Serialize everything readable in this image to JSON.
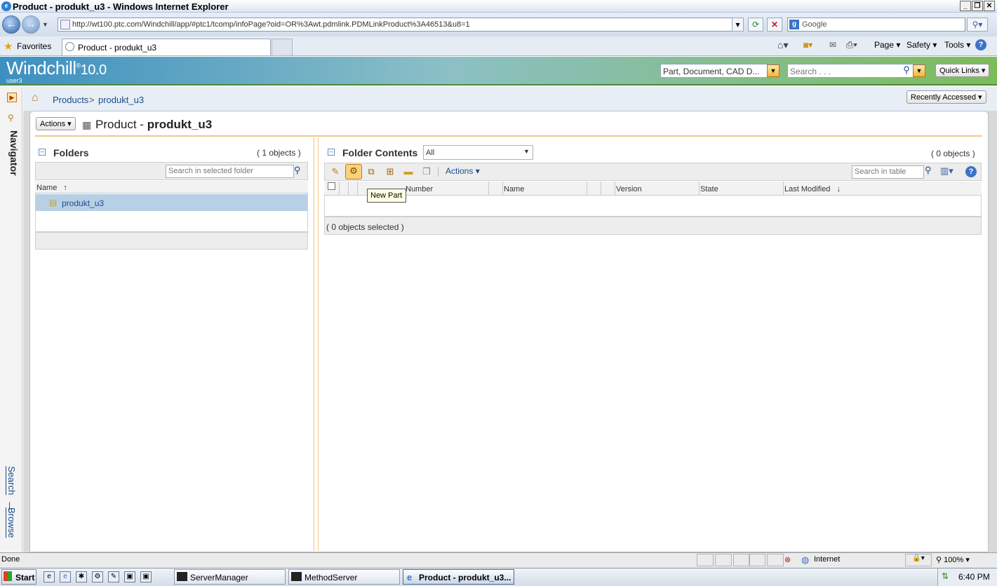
{
  "window": {
    "title": "Product - produkt_u3 - Windows Internet Explorer"
  },
  "browser": {
    "address": "http://wt100.ptc.com/Windchill/app/#ptc1/tcomp/infoPage?oid=OR%3Awt.pdmlink.PDMLinkProduct%3A46513&u8=1",
    "search_engine": "Google",
    "favorites_label": "Favorites",
    "tab_title": "Product - produkt_u3",
    "menus": [
      "Page",
      "Safety",
      "Tools"
    ]
  },
  "app": {
    "logo": "Windchill",
    "logo_reg": "®",
    "version": "10.0",
    "user": "user3",
    "search_type": "Part, Document, CAD D...",
    "search_placeholder": "Search . . .",
    "quick_links": "Quick Links",
    "recently_accessed": "Recently Accessed",
    "navigator_label": "Navigator",
    "search_link": "Search",
    "browse_link": "Browse",
    "link_sep": "|"
  },
  "breadcrumb": {
    "items": [
      "Products",
      "produkt_u3"
    ],
    "sep": ">"
  },
  "page": {
    "actions_label": "Actions",
    "title_prefix": "Product - ",
    "title_name": "produkt_u3"
  },
  "folders": {
    "title": "Folders",
    "count": "( 1 objects )",
    "search_placeholder": "Search in selected folder",
    "column": "Name",
    "sort_glyph": "↑",
    "rows": [
      "produkt_u3"
    ]
  },
  "contents": {
    "title": "Folder Contents",
    "filter": "All",
    "count": "( 0 objects )",
    "actions_label": "Actions",
    "search_placeholder": "Search in table",
    "columns": [
      "Number",
      "Name",
      "Version",
      "State",
      "Last Modified"
    ],
    "sort_glyph": "↓",
    "selected": "( 0 objects selected )",
    "tooltip": "New Part"
  },
  "status": {
    "text": "Done",
    "zone": "Internet",
    "zoom": "100%"
  },
  "taskbar": {
    "start": "Start",
    "buttons": [
      "ServerManager",
      "MethodServer",
      "Product - produkt_u3..."
    ],
    "clock": "6:40 PM"
  },
  "colors": {
    "header_blue": "#3c8fc1",
    "header_green": "#7dbb5a",
    "link": "#1a4b8e",
    "selected_row": "#b8d0e6"
  }
}
